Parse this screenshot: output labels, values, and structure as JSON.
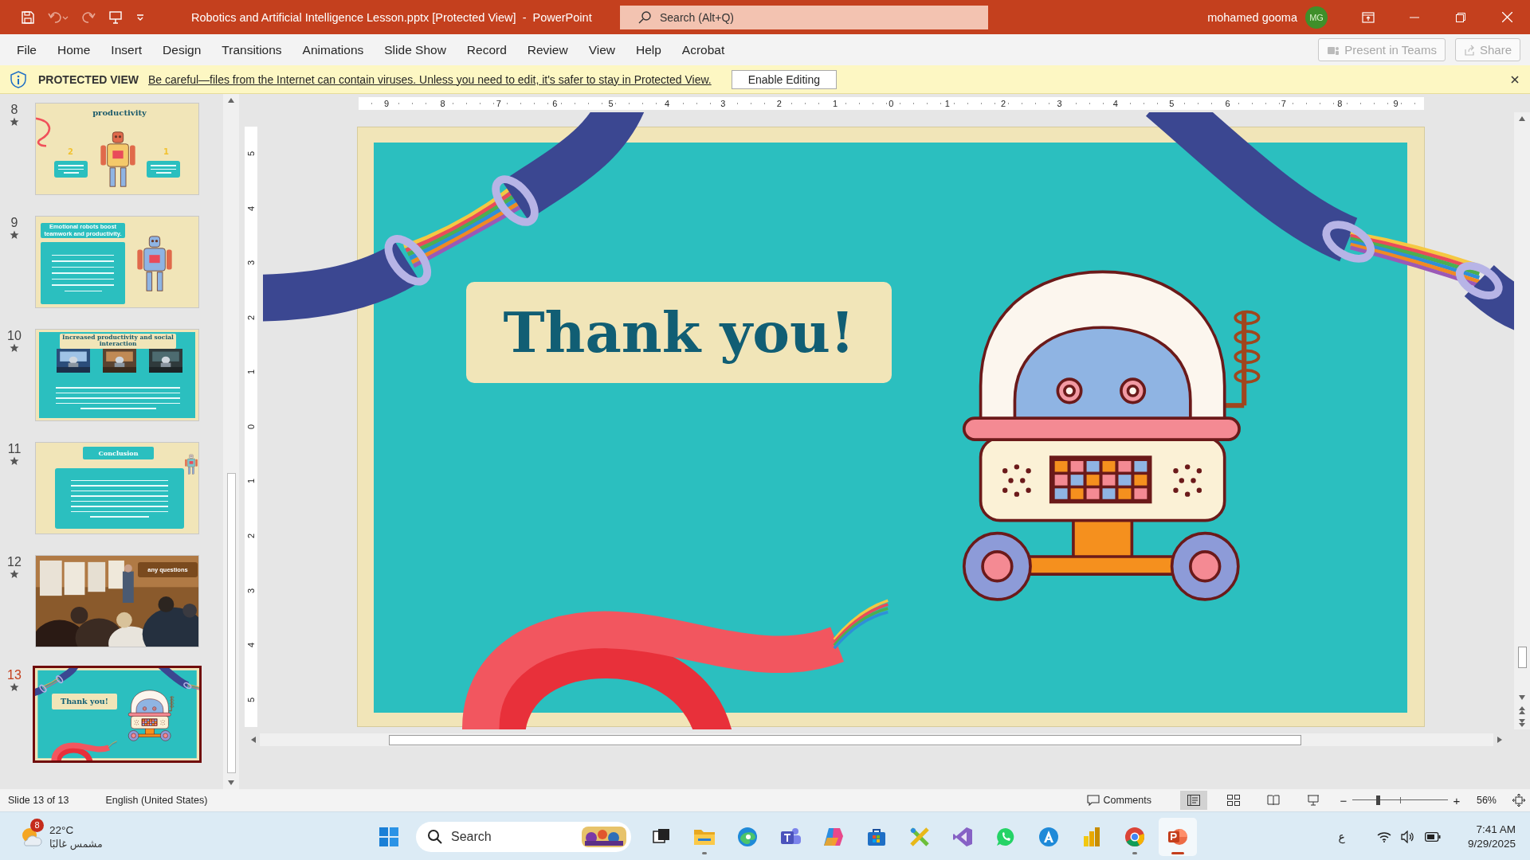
{
  "window": {
    "title": "Robotics and Artificial Intelligence Lesson.pptx [Protected View]  -  PowerPoint",
    "search_placeholder": "Search (Alt+Q)",
    "user": "mohamed gooma",
    "avatar": "MG"
  },
  "ribbon": {
    "tabs": [
      {
        "label": "File",
        "selected": false
      },
      {
        "label": "Home",
        "selected": false
      },
      {
        "label": "Insert",
        "selected": false
      },
      {
        "label": "Design",
        "selected": false
      },
      {
        "label": "Transitions",
        "selected": false
      },
      {
        "label": "Animations",
        "selected": false
      },
      {
        "label": "Slide Show",
        "selected": false
      },
      {
        "label": "Record",
        "selected": false
      },
      {
        "label": "Review",
        "selected": false
      },
      {
        "label": "View",
        "selected": false
      },
      {
        "label": "Help",
        "selected": false
      },
      {
        "label": "Acrobat",
        "selected": false
      }
    ],
    "buttons": [
      {
        "label": "Present in Teams",
        "disabled": true
      },
      {
        "label": "Share",
        "disabled": true
      }
    ]
  },
  "protected_view": {
    "label": "PROTECTED VIEW",
    "message": "Be careful—files from the Internet can contain viruses. Unless you need to edit, it's safer to stay in Protected View.",
    "button": "Enable Editing"
  },
  "slides": [
    {
      "number": "8",
      "kind": "robot",
      "title": "productivity",
      "boxes": [
        {
          "marker": "2"
        },
        {
          "marker": "1"
        }
      ],
      "selected": false
    },
    {
      "number": "9",
      "kind": "cards",
      "title": "Emotional robots boost teamwork and productivity.",
      "selected": false
    },
    {
      "number": "10",
      "kind": "photos",
      "title": "Increased productivity and social interaction",
      "selected": false
    },
    {
      "number": "11",
      "kind": "conclusion",
      "title": "Conclusion",
      "selected": false
    },
    {
      "number": "12",
      "title": "any questions",
      "selected": false
    },
    {
      "number": "13",
      "kind": "thanks",
      "title": "Thank you!",
      "selected": true
    }
  ],
  "rulers": {
    "horizontal": [
      "9",
      "8",
      "7",
      "6",
      "5",
      "4",
      "3",
      "2",
      "1",
      "0",
      "1",
      "2",
      "3",
      "4",
      "5",
      "6",
      "7",
      "8",
      "9"
    ],
    "vertical": [
      "5",
      "4",
      "3",
      "2",
      "1",
      "0",
      "1",
      "2",
      "3",
      "4",
      "5"
    ]
  },
  "slide": {
    "title": "Thank you!"
  },
  "status_bar": {
    "slide_info": "Slide 13 of 13",
    "language": "English (United States)",
    "comments": "Comments",
    "views": [
      {
        "kind": "normal",
        "selected": true
      },
      {
        "kind": "sorter",
        "selected": false
      },
      {
        "kind": "reading",
        "selected": false
      },
      {
        "kind": "slideshow",
        "selected": false
      }
    ],
    "zoom_out": "−",
    "zoom_in": "+",
    "zoom": {
      "level": 0.27,
      "reading": "56%"
    }
  },
  "taskbar": {
    "weather": {
      "badge": "8",
      "temperature": "22°C",
      "condition": "مشمس غالبًا"
    },
    "search_placeholder": "Search",
    "apps": [
      {
        "kind": "taskview",
        "running": false,
        "selected": false
      },
      {
        "kind": "folder",
        "running": true,
        "selected": false
      },
      {
        "kind": "edge",
        "running": false,
        "selected": false
      },
      {
        "kind": "teams",
        "running": false,
        "selected": false
      },
      {
        "kind": "copilot",
        "running": false,
        "selected": false
      },
      {
        "kind": "store",
        "running": false,
        "selected": false
      },
      {
        "kind": "tools",
        "running": false,
        "selected": false
      },
      {
        "kind": "vs",
        "running": false,
        "selected": false
      },
      {
        "kind": "chat",
        "running": false,
        "selected": false
      },
      {
        "kind": "acircle",
        "running": false,
        "selected": false
      },
      {
        "kind": "bars",
        "running": false,
        "selected": false
      },
      {
        "kind": "chrome",
        "running": true,
        "selected": false
      },
      {
        "kind": "ppt",
        "running": true,
        "selected": true
      }
    ],
    "input_language": "ع",
    "time": "7:41 AM",
    "date": "9/29/2025"
  }
}
